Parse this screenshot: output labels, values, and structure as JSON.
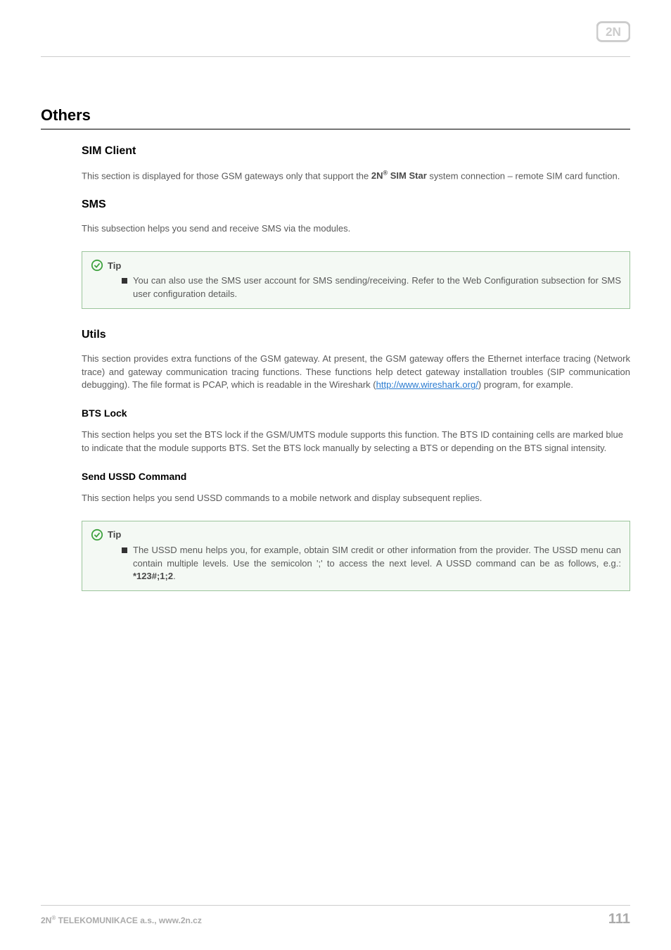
{
  "logo": {
    "name": "2N"
  },
  "sections": {
    "main_title": "Others",
    "sim_client": {
      "title": "SIM Client",
      "para_before": "This section is displayed for those GSM gateways only that support the ",
      "brand": "2N",
      "brand_suffix": " SIM Star",
      "para_after": " system connection – remote SIM card function."
    },
    "sms": {
      "title": "SMS",
      "para": "This subsection helps you send and receive SMS via the modules.",
      "tip_label": "Tip",
      "tip_text": "You can also use the SMS user account for SMS sending/receiving. Refer to the Web Configuration subsection for SMS user configuration details."
    },
    "utils": {
      "title": "Utils",
      "para_before": "This section provides extra functions of the GSM gateway. At present, the GSM gateway offers the Ethernet interface tracing (Network trace) and gateway communication tracing functions. These functions help detect gateway installation troubles (SIP communication debugging). The file format is PCAP, which is readable in the Wireshark (",
      "link_text": "http://www.wireshark.org/",
      "para_after": ") program, for example."
    },
    "bts": {
      "title": "BTS Lock",
      "para": "This section helps you set the BTS lock if the GSM/UMTS module supports this function. The BTS ID containing cells are marked blue to indicate that the module supports BTS. Set the BTS lock manually by selecting a BTS or depending on the BTS signal intensity."
    },
    "ussd": {
      "title": "Send USSD Command",
      "para": "This section helps you send USSD commands to a mobile network and display subsequent replies.",
      "tip_label": "Tip",
      "tip_text_before": "The USSD menu helps you, for example, obtain SIM credit or other information from the provider. The USSD menu can contain multiple levels. Use the semicolon ';' to access the next level. A USSD command can be as follows, e.g.: ",
      "tip_code": "*123#;1;2",
      "tip_text_after": "."
    }
  },
  "footer": {
    "company_prefix": "2N",
    "company_suffix": " TELEKOMUNIKACE a.s., www.2n.cz",
    "page_number": "111"
  }
}
